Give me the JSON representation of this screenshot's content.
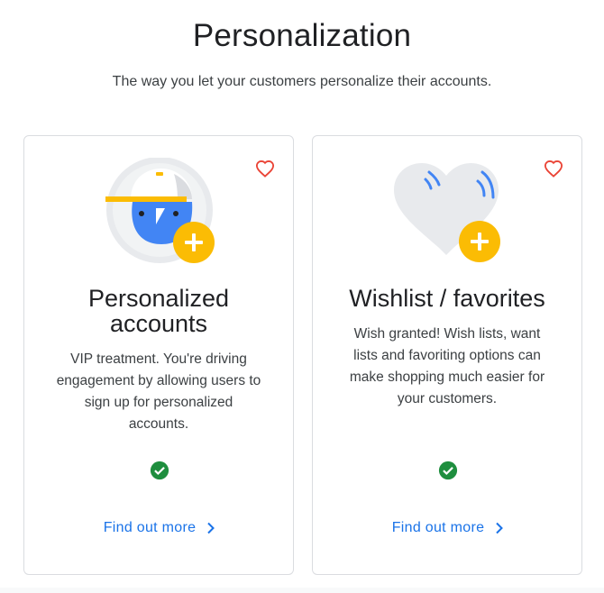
{
  "header": {
    "title": "Personalization",
    "subtitle": "The way you let your customers personalize their accounts."
  },
  "cards": [
    {
      "title_line1": "Personalized",
      "title_line2": "accounts",
      "desc_lines": [
        "VIP treatment. You're driving",
        "engagement by allowing users to",
        "sign up for personalized",
        "accounts."
      ],
      "link_label": "Find out more",
      "icons": [
        "heart-outline-icon",
        "user-cap-illustration",
        "plus-icon",
        "check-circle-icon",
        "chevron-right-icon"
      ]
    },
    {
      "title_line1": "Wishlist / favorites",
      "desc_lines": [
        "Wish granted! Wish lists, want",
        "lists and favoriting options can",
        "make shopping much easier for",
        "your customers."
      ],
      "link_label": "Find out more",
      "icons": [
        "heart-outline-icon",
        "heart-illustration",
        "plus-icon",
        "check-circle-icon",
        "chevron-right-icon"
      ]
    }
  ],
  "colors": {
    "accent_blue": "#1a73e8",
    "heart_red": "#ea4335",
    "check_green": "#1e8e3e",
    "plus_yellow": "#fbbc04",
    "illustration_blue": "#4285f4"
  }
}
